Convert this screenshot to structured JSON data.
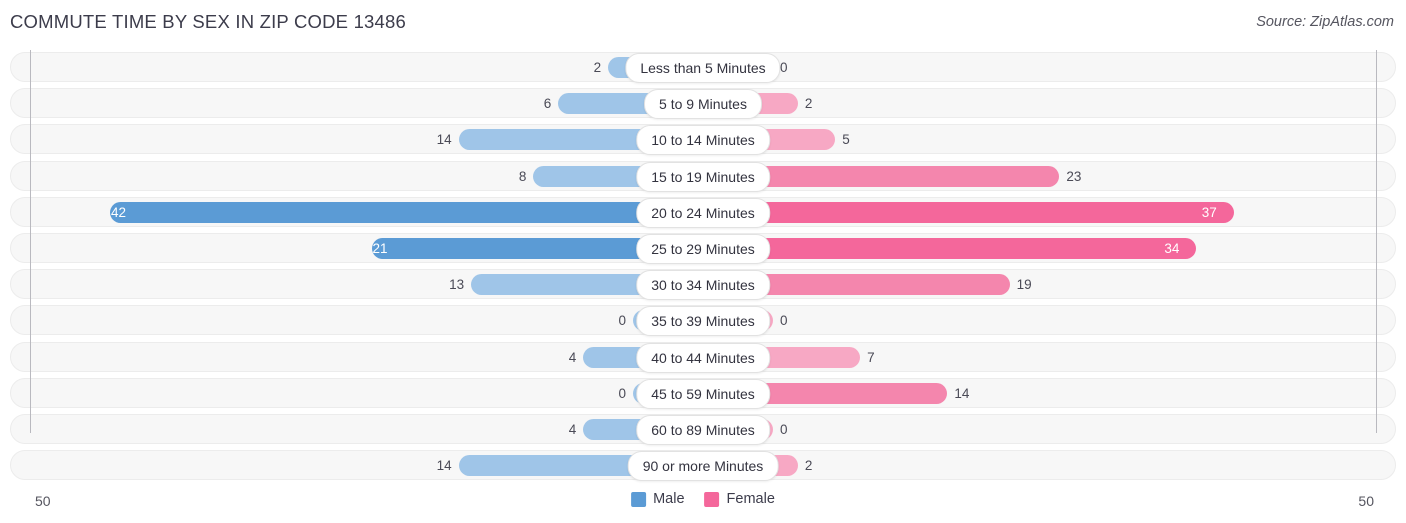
{
  "header": {
    "title": "COMMUTE TIME BY SEX IN ZIP CODE 13486",
    "source": "Source: ZipAtlas.com"
  },
  "axis": {
    "left_tick": "50",
    "right_tick": "50",
    "max": 50
  },
  "legend": {
    "items": [
      {
        "label": "Male",
        "color": "#5b9bd5"
      },
      {
        "label": "Female",
        "color": "#f4679b"
      }
    ]
  },
  "colors": {
    "male_light": "#9fc5e8",
    "male_strong": "#5b9bd5",
    "female_light": "#f7a8c4",
    "female_mid": "#f486ad",
    "female_strong": "#f4679b",
    "track": "#f7f7f7",
    "axis": "#b9b9bf"
  },
  "chart_data": {
    "type": "bar",
    "title": "COMMUTE TIME BY SEX IN ZIP CODE 13486",
    "subtitle": "",
    "orientation": "horizontal-diverging",
    "xlabel": "",
    "ylabel": "",
    "xlim": [
      -50,
      50
    ],
    "grid": false,
    "legend_position": "bottom-center",
    "categories": [
      "Less than 5 Minutes",
      "5 to 9 Minutes",
      "10 to 14 Minutes",
      "15 to 19 Minutes",
      "20 to 24 Minutes",
      "25 to 29 Minutes",
      "30 to 34 Minutes",
      "35 to 39 Minutes",
      "40 to 44 Minutes",
      "45 to 59 Minutes",
      "60 to 89 Minutes",
      "90 or more Minutes"
    ],
    "series": [
      {
        "name": "Male",
        "values": [
          2,
          6,
          14,
          8,
          42,
          21,
          13,
          0,
          4,
          0,
          4,
          14
        ]
      },
      {
        "name": "Female",
        "values": [
          0,
          2,
          5,
          23,
          37,
          34,
          19,
          0,
          7,
          14,
          0,
          2
        ]
      }
    ]
  },
  "rows": [
    {
      "label": "Less than 5 Minutes",
      "male": "2",
      "female": "0",
      "male_value": 2,
      "female_value": 0
    },
    {
      "label": "5 to 9 Minutes",
      "male": "6",
      "female": "2",
      "male_value": 6,
      "female_value": 2
    },
    {
      "label": "10 to 14 Minutes",
      "male": "14",
      "female": "5",
      "male_value": 14,
      "female_value": 5
    },
    {
      "label": "15 to 19 Minutes",
      "male": "8",
      "female": "23",
      "male_value": 8,
      "female_value": 23
    },
    {
      "label": "20 to 24 Minutes",
      "male": "42",
      "female": "37",
      "male_value": 42,
      "female_value": 37
    },
    {
      "label": "25 to 29 Minutes",
      "male": "21",
      "female": "34",
      "male_value": 21,
      "female_value": 34
    },
    {
      "label": "30 to 34 Minutes",
      "male": "13",
      "female": "19",
      "male_value": 13,
      "female_value": 19
    },
    {
      "label": "35 to 39 Minutes",
      "male": "0",
      "female": "0",
      "male_value": 0,
      "female_value": 0
    },
    {
      "label": "40 to 44 Minutes",
      "male": "4",
      "female": "7",
      "male_value": 4,
      "female_value": 7
    },
    {
      "label": "45 to 59 Minutes",
      "male": "0",
      "female": "14",
      "male_value": 0,
      "female_value": 14
    },
    {
      "label": "60 to 89 Minutes",
      "male": "4",
      "female": "0",
      "male_value": 4,
      "female_value": 0
    },
    {
      "label": "90 or more Minutes",
      "male": "14",
      "female": "2",
      "male_value": 14,
      "female_value": 2
    }
  ]
}
